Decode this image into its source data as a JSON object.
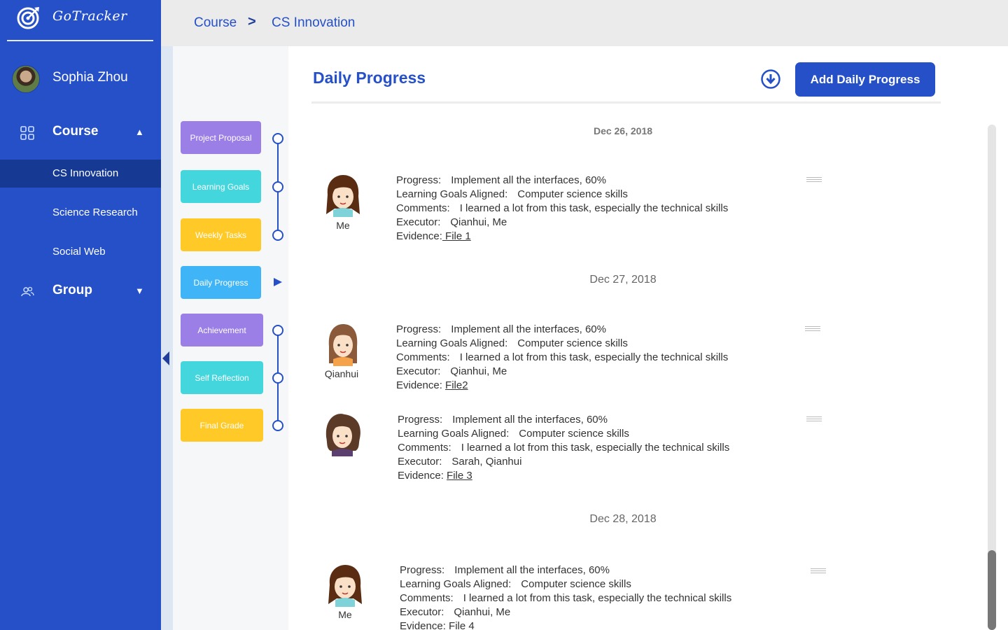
{
  "app": {
    "name": "GoTracker"
  },
  "user": {
    "name": "Sophia Zhou"
  },
  "sidebar": {
    "course": {
      "label": "Course",
      "caret": "▲"
    },
    "courses": [
      {
        "label": "CS Innovation",
        "active": true
      },
      {
        "label": "Science Research",
        "active": false
      },
      {
        "label": "Social Web",
        "active": false
      }
    ],
    "group": {
      "label": "Group",
      "caret": "▼"
    }
  },
  "breadcrumb": {
    "items": [
      "Course",
      "CS Innovation"
    ],
    "separator": ">"
  },
  "stages": [
    {
      "label": "Project Proposal",
      "color": "#9b7fe6"
    },
    {
      "label": "Learning Goals",
      "color": "#44d6dd"
    },
    {
      "label": "Weekly Tasks",
      "color": "#ffc928"
    },
    {
      "label": "Daily Progress",
      "color": "#3fb5f7",
      "current": true
    },
    {
      "label": "Achievement",
      "color": "#9b7fe6"
    },
    {
      "label": "Self Reflection",
      "color": "#44d6dd"
    },
    {
      "label": "Final Grade",
      "color": "#ffc928"
    }
  ],
  "main": {
    "title": "Daily Progress",
    "add_button": "Add Daily Progress",
    "download_icon": "download-circle-icon"
  },
  "labels": {
    "progress": "Progress:",
    "goals": "Learning Goals Aligned:",
    "comments": "Comments:",
    "executor": "Executor:",
    "evidence": "Evidence:"
  },
  "days": [
    {
      "date": "Dec 26, 2018",
      "entries": [
        {
          "avatar_name": "Me",
          "progress": "Implement all the interfaces, 60%",
          "goals": "Computer science skills",
          "comments": "I learned a lot from this task, especially the technical skills",
          "executor": "Qianhui, Me",
          "evidence": " File 1"
        }
      ]
    },
    {
      "date": "Dec 27, 2018",
      "entries": [
        {
          "avatar_name": "Qianhui",
          "progress": "Implement all the interfaces, 60%",
          "goals": "Computer science skills",
          "comments": "I learned a lot from this task, especially the technical skills",
          "executor": "Qianhui, Me",
          "evidence": "File2"
        },
        {
          "avatar_name": "",
          "progress": "Implement all the interfaces, 60%",
          "goals": "Computer science skills",
          "comments": "I learned a lot from this task, especially the technical skills",
          "executor": "Sarah, Qianhui",
          "evidence": "File 3"
        }
      ]
    },
    {
      "date": "Dec 28, 2018",
      "entries": [
        {
          "avatar_name": "Me",
          "progress": "Implement all the interfaces, 60%",
          "goals": "Computer science skills",
          "comments": "I learned a lot from this task, especially the technical skills",
          "executor": "Qianhui, Me",
          "evidence": "File 4"
        }
      ]
    }
  ]
}
